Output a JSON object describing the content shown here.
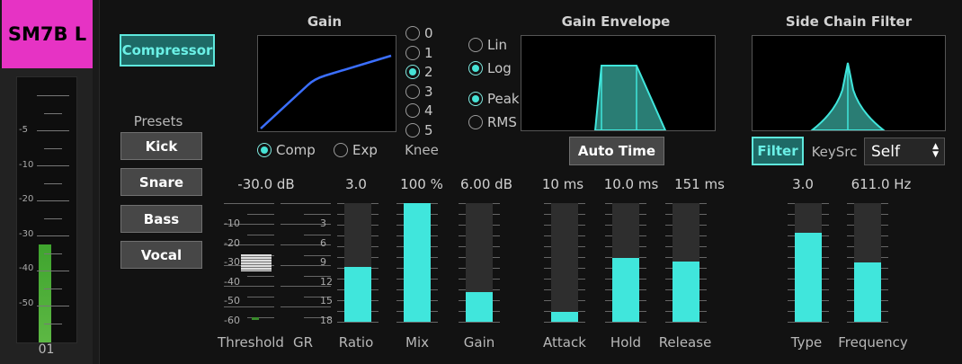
{
  "track": {
    "name": "SM7B L",
    "channel_number": "01",
    "meter_level_fraction": 0.37
  },
  "meter_scale": [
    "-5",
    "-10",
    "-20",
    "-30",
    "-40",
    "-50"
  ],
  "compressor_button": "Compressor",
  "presets": {
    "title": "Presets",
    "items": [
      "Kick",
      "Snare",
      "Bass",
      "Vocal"
    ]
  },
  "gain": {
    "title": "Gain",
    "comp_label": "Comp",
    "exp_label": "Exp",
    "mode_selected": "Comp"
  },
  "knee": {
    "label": "Knee",
    "options": [
      "0",
      "1",
      "2",
      "3",
      "4",
      "5"
    ],
    "selected": "2"
  },
  "gain_envelope": {
    "title": "Gain Envelope",
    "lin_label": "Lin",
    "log_label": "Log",
    "scale_selected": "Log",
    "peak_label": "Peak",
    "rms_label": "RMS",
    "detect_selected": "Peak",
    "auto_time_button": "Auto Time"
  },
  "side_chain": {
    "title": "Side Chain Filter",
    "filter_button": "Filter",
    "keysrc_label": "KeySrc",
    "keysrc_value": "Self"
  },
  "threshold": {
    "label": "Threshold",
    "value": "-30.0 dB",
    "scale": [
      "-10",
      "-20",
      "-30",
      "-40",
      "-50",
      "-60"
    ]
  },
  "gr": {
    "label": "GR",
    "scale": [
      "3",
      "6",
      "9",
      "12",
      "15",
      "18"
    ]
  },
  "controls": [
    {
      "label": "Ratio",
      "value": "3.0",
      "fraction": 0.46
    },
    {
      "label": "Mix",
      "value": "100 %",
      "fraction": 1.0
    },
    {
      "label": "Gain",
      "value": "6.00 dB",
      "fraction": 0.25
    },
    {
      "label": "Attack",
      "value": "10 ms",
      "fraction": 0.08
    },
    {
      "label": "Hold",
      "value": "10.0 ms",
      "fraction": 0.54
    },
    {
      "label": "Release",
      "value": "151 ms",
      "fraction": 0.51
    },
    {
      "label": "Type",
      "value": "3.0",
      "fraction": 0.75
    },
    {
      "label": "Frequency",
      "value": "611.0 Hz",
      "fraction": 0.5
    }
  ],
  "colors": {
    "accent": "#40e6dc",
    "track_pink": "#e633c4",
    "gain_curve": "#3b6fff",
    "meter_green": "#4caf34"
  }
}
